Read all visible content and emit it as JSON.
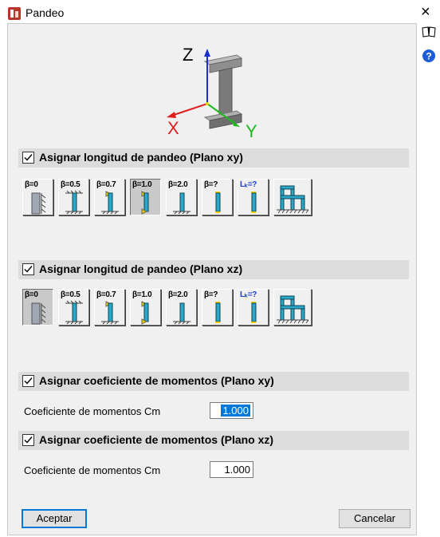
{
  "window": {
    "title": "Pandeo",
    "close_glyph": "×"
  },
  "side_icons": [
    "book-icon",
    "help-icon"
  ],
  "axis_labels": {
    "z": "Z",
    "x": "X",
    "y": "Y"
  },
  "sections": {
    "plane_xy": {
      "label": "Asignar longitud de pandeo (Plano xy)",
      "checked": true
    },
    "plane_xz": {
      "label": "Asignar longitud de pandeo (Plano xz)",
      "checked": true
    },
    "moment_xy": {
      "label": "Asignar coeficiente de momentos (Plano xy)",
      "checked": true
    },
    "moment_xz": {
      "label": "Asignar coeficiente de momentos (Plano xz)",
      "checked": true
    }
  },
  "buckling_buttons": {
    "b0": "β=0",
    "b05": "β=0.5",
    "b07": "β=0.7",
    "b10": "β=1.0",
    "b20": "β=2.0",
    "bq": "β=?",
    "lk": "Lₖ=?"
  },
  "row_xy_selected": "β=1.0",
  "row_xz_selected": "β=0",
  "moment_xy": {
    "label": "Coeficiente de momentos Cm",
    "value": "1.000"
  },
  "moment_xz": {
    "label": "Coeficiente de momentos Cm",
    "value": "1.000"
  },
  "footer": {
    "accept": "Aceptar",
    "cancel": "Cancelar"
  },
  "colors": {
    "accent": "#0078d7",
    "column": "#2aa8c8",
    "support": "#f5d000",
    "section_bg": "#dcdcdc",
    "dialog_bg": "#f0f0f0"
  }
}
